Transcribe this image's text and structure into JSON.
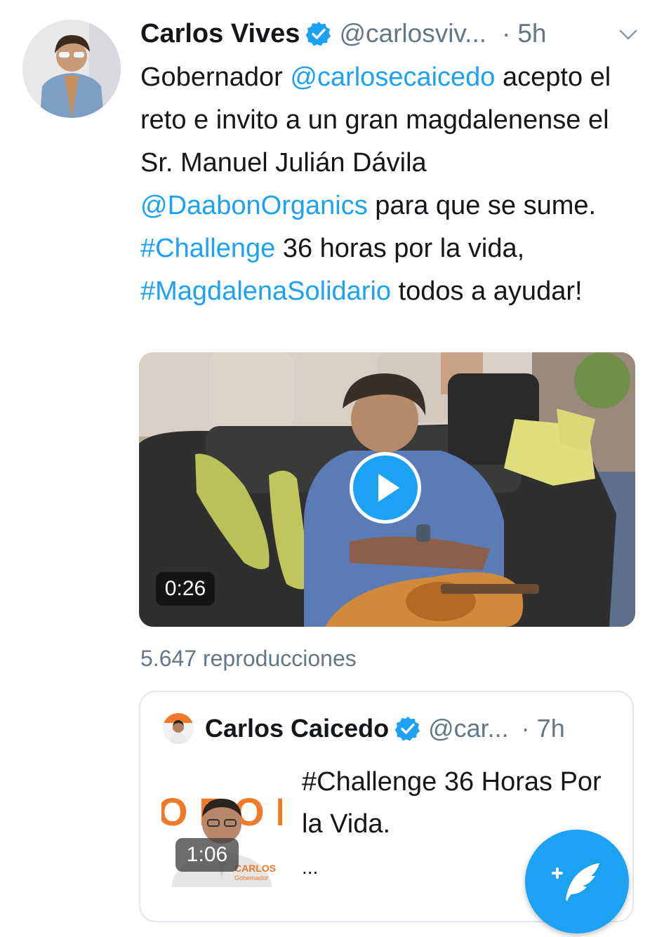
{
  "tweet": {
    "author_name": "Carlos Vives",
    "handle": "@carlosviv...",
    "separator": "·",
    "time": "5h",
    "text_parts": [
      {
        "text": "Gobernador ",
        "link": false
      },
      {
        "text": "@carlosecaicedo",
        "link": true
      },
      {
        "text": " acepto el reto e invito a un gran magdalenense el Sr.  Manuel Julián Dávila ",
        "link": false
      },
      {
        "text": "@DaabonOrganics",
        "link": true
      },
      {
        "text": "  para que se sume. ",
        "link": false
      },
      {
        "text": "#Challenge",
        "link": true
      },
      {
        "text": " 36 horas por la vida, ",
        "link": false
      },
      {
        "text": "#MagdalenaSolidario",
        "link": true
      },
      {
        "text": " todos a ayudar!",
        "link": false
      }
    ],
    "video_duration": "0:26",
    "views": "5.647 reproducciones"
  },
  "quoted": {
    "author_name": "Carlos Caicedo",
    "handle": "@car...",
    "separator": "·",
    "time": "7h",
    "text": "#Challenge 36 Horas Por la Vida.",
    "ellipsis": "...",
    "video_duration": "1:06",
    "thumb_banner_letters": "OFOI",
    "thumb_caption": "CARLOS",
    "thumb_caption_sub": "Gobernador"
  },
  "compose_button": {
    "icon": "compose-feather-icon"
  },
  "colors": {
    "link": "#1da1f2",
    "secondary": "#657786",
    "verified": "#1da1f2"
  },
  "icons": {
    "verified": "verified-badge-icon",
    "chevron": "chevron-down-icon",
    "play": "play-icon"
  }
}
